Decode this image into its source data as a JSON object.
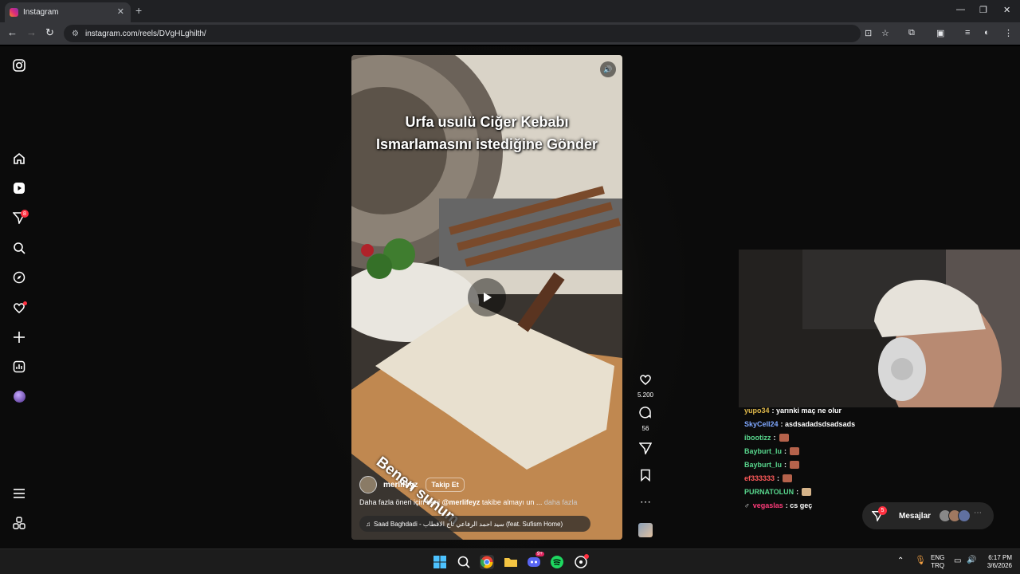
{
  "browser": {
    "tab_title": "Instagram",
    "url": "instagram.com/reels/DVgHLghilth/"
  },
  "sidebar": {
    "badges": {
      "messages": "8"
    }
  },
  "reel": {
    "overlay_line1": "Urfa usulü Ciğer Kebabı",
    "overlay_line2": "Ismarlamasını istediğine Gönder",
    "overlay_bottom": "Benen sunum",
    "author": "merlifeyz",
    "follow_label": "Takip Et",
    "caption_start": "Daha fazla öneri için beni ",
    "caption_mention": "@merlifeyz",
    "caption_end": " takibe almayı un ... ",
    "caption_more": "daha fazla",
    "audio": "Saad Baghdadi - سيد احمد الرفاعي تاج الاقطاب (feat. Sufism Home)",
    "likes": "5.200",
    "comments": "56"
  },
  "chat": [
    {
      "user": "yupo34",
      "color": "#e0b94b",
      "text": ": yarınki maç ne olur"
    },
    {
      "user": "SkyCell24",
      "color": "#7fa7ff",
      "text": ": asdsadadsdsadsads"
    },
    {
      "user": "ibootizz",
      "color": "#58d68d",
      "text": ":"
    },
    {
      "user": "Bayburt_lu",
      "color": "#58d68d",
      "text": ":"
    },
    {
      "user": "Bayburt_lu",
      "color": "#58d68d",
      "text": ":"
    },
    {
      "user": "ef333333",
      "color": "#ff5a5a",
      "text": ":"
    },
    {
      "user": "PURNATOLUN",
      "color": "#58d68d",
      "text": ":"
    },
    {
      "user": "vegaslas",
      "color": "#ff3b7a",
      "text": ": cs geç"
    }
  ],
  "messages_bar": {
    "label": "Mesajlar",
    "badge": "5"
  },
  "taskbar": {
    "lang1": "ENG",
    "lang2": "TRQ",
    "time": "6:17 PM",
    "date": "3/6/2026",
    "discord_badge": "9+"
  },
  "colors": {
    "accent_red": "#ff3040",
    "page_bg": "#0b0b0b"
  }
}
